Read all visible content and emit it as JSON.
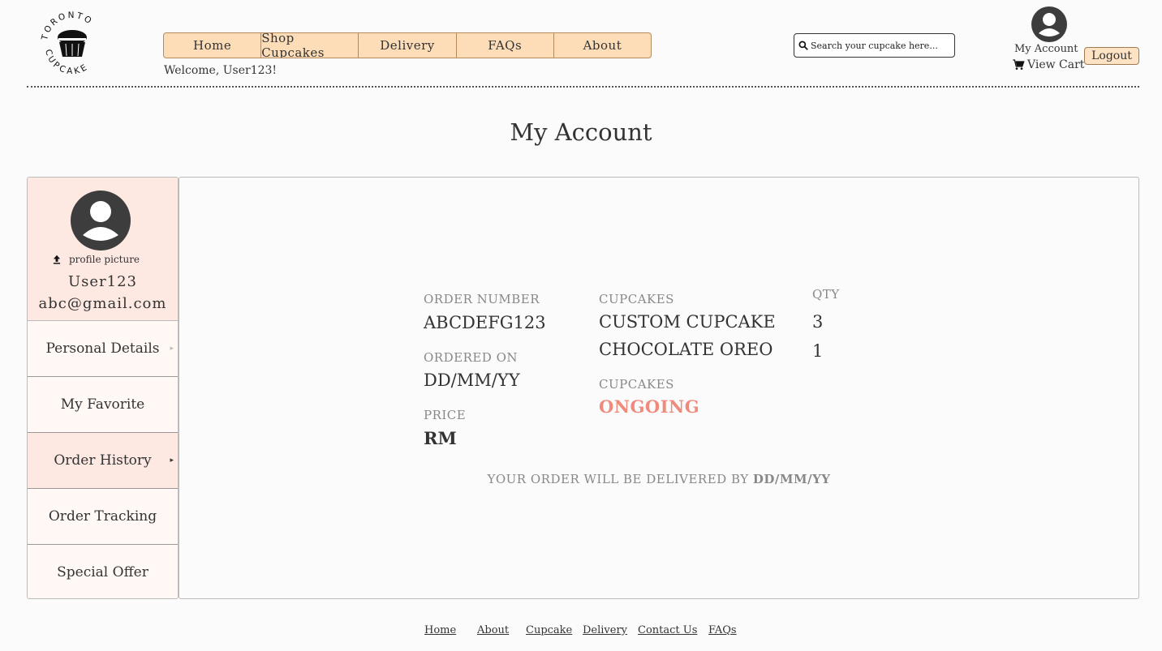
{
  "brand": {
    "logo_text_top": "TORONTO",
    "logo_text_bottom": "CUPCAKE"
  },
  "nav": {
    "items": [
      "Home",
      "Shop Cupcakes",
      "Delivery",
      "FAQs",
      "About"
    ]
  },
  "welcome": "Welcome, User123!",
  "search": {
    "placeholder": "Search your cupcake here..."
  },
  "account": {
    "my_account": "My Account",
    "view_cart": "View Cart",
    "logout": "Logout"
  },
  "page_title": "My Account",
  "sidebar": {
    "upload_label": "profile picture",
    "username": "User123",
    "email": "abc@gmail.com",
    "items": [
      {
        "label": "Personal Details",
        "arrow": "▸"
      },
      {
        "label": "My Favorite",
        "arrow": ""
      },
      {
        "label": "Order History",
        "arrow": "▸"
      },
      {
        "label": "Order Tracking",
        "arrow": ""
      },
      {
        "label": "Special Offer",
        "arrow": ""
      }
    ],
    "active_index": 2
  },
  "order": {
    "order_number_label": "ORDER NUMBER",
    "order_number": "ABCDEFG123",
    "ordered_on_label": "ORDERED ON",
    "ordered_on": "DD/MM/YY",
    "price_label": "PRICE",
    "price": "RM",
    "cupcakes_label": "CUPCAKES",
    "items": [
      {
        "name": "CUSTOM CUPCAKE",
        "qty": "3"
      },
      {
        "name": "CHOCOLATE OREO",
        "qty": "1"
      }
    ],
    "qty_label": "QTY",
    "status_label": "CUPCAKES",
    "status": "ONGOING",
    "delivery_prefix": "YOUR ORDER WILL BE DELIVERED BY",
    "delivery_date": "DD/MM/YY"
  },
  "footer": {
    "links": [
      "Home",
      "About",
      "Cupcake",
      "Delivery",
      "Contact Us",
      "FAQs"
    ]
  },
  "colors": {
    "nav_bg": "#fddcb8",
    "sidebar_profile_bg": "#fde8e2",
    "status_color": "#f08a7d",
    "avatar": "#3d3d3d"
  }
}
